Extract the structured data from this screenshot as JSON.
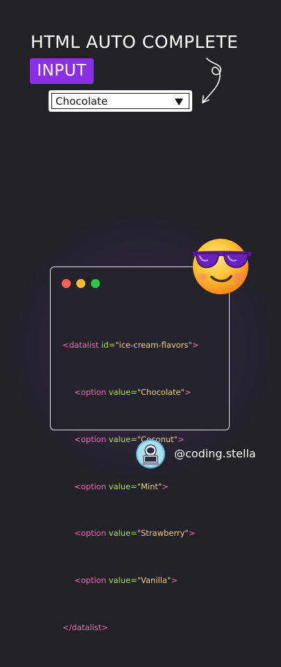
{
  "header": {
    "title": "HTML AUTO COMPLETE",
    "badge": "INPUT"
  },
  "select": {
    "value": "Chocolate",
    "icon": "dropdown-triangle"
  },
  "code_window": {
    "dot_colors": [
      "#ff5f57",
      "#febc2e",
      "#28c840"
    ],
    "lines": [
      {
        "open": "<datalist",
        "attr": "id=",
        "value": "\"ice-cream-flavors\"",
        "close": ">"
      },
      {
        "open": "<option",
        "attr": "value=",
        "value": "\"Chocolate\"",
        "close": ">"
      },
      {
        "open": "<option",
        "attr": "value=",
        "value": "\"Coconut\"",
        "close": ">"
      },
      {
        "open": "<option",
        "attr": "value=",
        "value": "\"Mint\"",
        "close": ">"
      },
      {
        "open": "<option",
        "attr": "value=",
        "value": "\"Strawberry\"",
        "close": ">"
      },
      {
        "open": "<option",
        "attr": "value=",
        "value": "\"Vanilla\"",
        "close": ">"
      },
      {
        "open": "</datalist>",
        "attr": "",
        "value": "",
        "close": ""
      }
    ]
  },
  "decorations": {
    "emoji": "sunglasses-emoji",
    "arrow": "curly-arrow-icon",
    "accent": "#8b2ee6"
  },
  "footer": {
    "handle": "@coding.stella",
    "avatar_icon": "astronaut-laptop-avatar"
  }
}
